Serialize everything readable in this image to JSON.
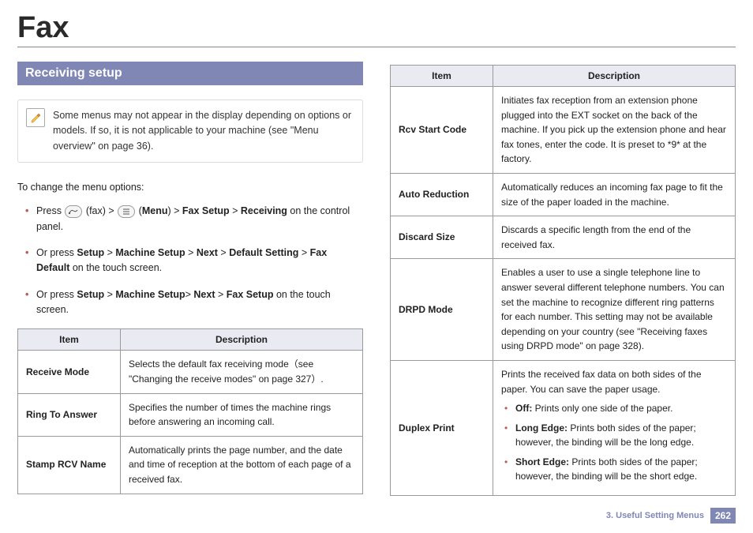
{
  "title": "Fax",
  "section_heading": "Receiving setup",
  "note": "Some menus may not appear in the display depending on options or models. If so, it is not applicable to your machine (see \"Menu overview\" on page 36).",
  "intro": "To change the menu options:",
  "steps": {
    "s1_press": "Press",
    "s1_fax": " (fax) > ",
    "s1_menu_open": " (",
    "s1_menu": "Menu",
    "s1_menu_close": ") > ",
    "s1_faxsetup": "Fax Setup",
    "s1_gt": " > ",
    "s1_receiving": "Receiving",
    "s1_tail": " on the control panel.",
    "s2_pre": "Or press ",
    "s2_a": "Setup",
    "s2_gt1": " > ",
    "s2_b": "Machine Setup",
    "s2_gt2": " > ",
    "s2_c": "Next",
    "s2_gt3": " > ",
    "s2_d": "Default Setting",
    "s2_gt4": " > ",
    "s2_e": "Fax Default",
    "s2_tail": " on the touch screen.",
    "s3_pre": "Or press ",
    "s3_a": "Setup",
    "s3_gt1": " > ",
    "s3_b": "Machine Setup",
    "s3_gt2": "> ",
    "s3_c": "Next",
    "s3_gt3": " > ",
    "s3_d": "Fax Setup",
    "s3_tail": " on the touch screen."
  },
  "table_headers": {
    "item": "Item",
    "desc": "Description"
  },
  "left_table": [
    {
      "item": "Receive Mode",
      "desc": "Selects the default fax receiving mode（see \"Changing the receive modes\" on page 327）."
    },
    {
      "item": "Ring To Answer",
      "desc": "Specifies the number of times the machine rings before answering an incoming call."
    },
    {
      "item": "Stamp RCV Name",
      "desc": "Automatically prints the page number, and the date and time of reception at the bottom of each page of a received fax."
    }
  ],
  "right_table": {
    "r1": {
      "item": "Rcv Start Code",
      "desc": "Initiates fax reception from an extension phone plugged into the EXT socket on the back of the machine. If you pick up the extension phone and hear fax tones, enter the code. It is preset to *9* at the factory."
    },
    "r2": {
      "item": "Auto Reduction",
      "desc": "Automatically reduces an incoming fax page to fit the size of the paper loaded in the machine."
    },
    "r3": {
      "item": "Discard Size",
      "desc": "Discards a specific length from the end of the received fax."
    },
    "r4": {
      "item": "DRPD Mode",
      "desc": " Enables a user to use a single telephone line to answer several different telephone numbers. You can set the machine to recognize different ring patterns for each number. This setting may not be available depending on your country (see \"Receiving faxes using DRPD mode\" on page 328)."
    },
    "r5": {
      "item": "Duplex Print",
      "lead": "Prints the received fax data on both sides of the paper. You can save the paper usage.",
      "b1_label": "Off:",
      "b1_text": " Prints only one side of the paper.",
      "b2_label": "Long Edge:",
      "b2_text": "  Prints both sides of the paper; however, the binding will be the long edge.",
      "b3_label": "Short Edge:",
      "b3_text": " Prints both sides of the paper; however, the binding will be the short edge."
    }
  },
  "footer": {
    "chapter": "3.  Useful Setting Menus",
    "page": "262"
  }
}
